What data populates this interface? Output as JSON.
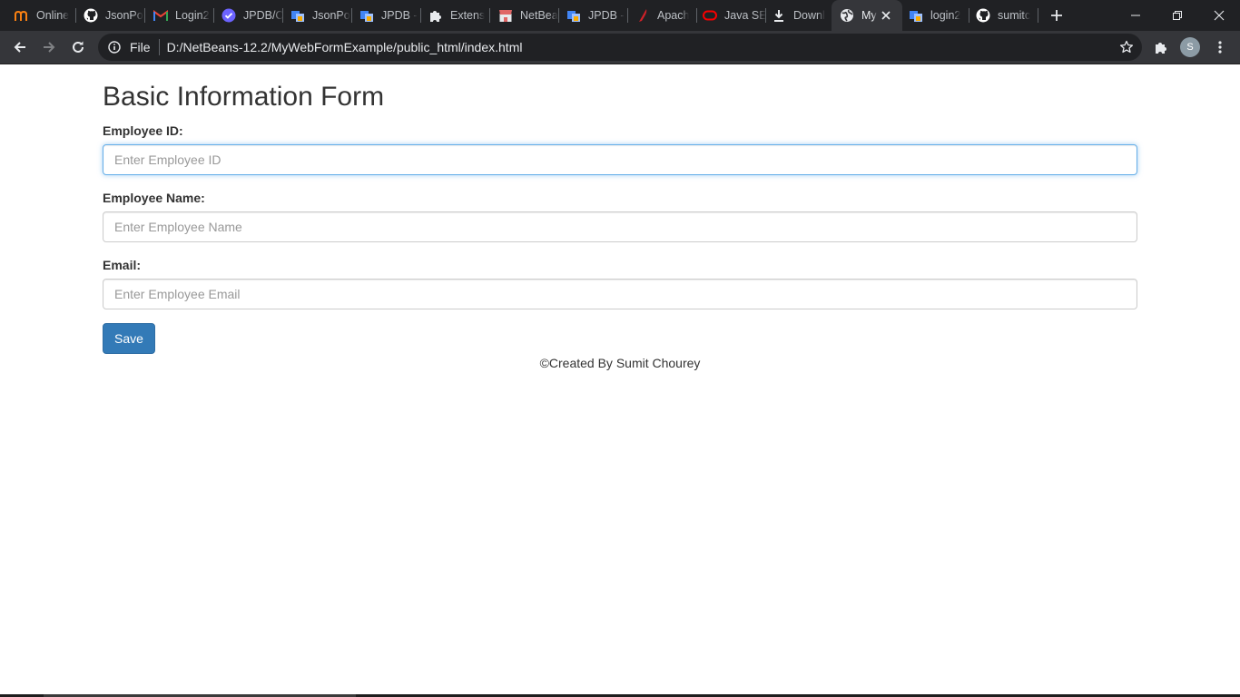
{
  "browser": {
    "tabs": [
      {
        "label": "Online",
        "icon": "moodle-icon",
        "color": "#f98012"
      },
      {
        "label": "JsonPo",
        "icon": "github-icon",
        "color": "#ffffff"
      },
      {
        "label": "Login2",
        "icon": "gmail-icon",
        "color": "#ea4335"
      },
      {
        "label": "JPDB/C",
        "icon": "check-badge-icon",
        "color": "#6c63ff"
      },
      {
        "label": "JsonPo",
        "icon": "cube-icon",
        "color": "#4285f4"
      },
      {
        "label": "JPDB -",
        "icon": "cube-icon",
        "color": "#4285f4"
      },
      {
        "label": "Extens",
        "icon": "puzzle-icon",
        "color": "#e8eaed"
      },
      {
        "label": "NetBea",
        "icon": "store-icon",
        "color": "#e06666"
      },
      {
        "label": "JPDB -",
        "icon": "cube-icon",
        "color": "#4285f4"
      },
      {
        "label": "Apach",
        "icon": "feather-icon",
        "color": "#d22128"
      },
      {
        "label": "Java SE",
        "icon": "oracle-icon",
        "color": "#f80000"
      },
      {
        "label": "Downl",
        "icon": "download-icon",
        "color": "#e8eaed"
      },
      {
        "label": "My",
        "icon": "globe-icon",
        "color": "#e8eaed",
        "active": true
      },
      {
        "label": "login2",
        "icon": "cube-icon",
        "color": "#4285f4"
      },
      {
        "label": "sumitc",
        "icon": "github-icon",
        "color": "#ffffff"
      }
    ],
    "address": {
      "scheme_chip": "File",
      "url": "D:/NetBeans-12.2/MyWebFormExample/public_html/index.html"
    },
    "profile_initial": "S"
  },
  "form": {
    "title": "Basic Information Form",
    "fields": [
      {
        "label": "Employee ID:",
        "placeholder": "Enter Employee ID",
        "value": "",
        "focused": true
      },
      {
        "label": "Employee Name:",
        "placeholder": "Enter Employee Name",
        "value": ""
      },
      {
        "label": "Email:",
        "placeholder": "Enter Employee Email",
        "value": ""
      }
    ],
    "save_label": "Save",
    "footer": "©Created By Sumit Chourey"
  },
  "colors": {
    "primary_button": "#337ab7",
    "focus_border": "#66afe9",
    "chrome_dark": "#202124",
    "chrome_toolbar": "#35363a"
  }
}
